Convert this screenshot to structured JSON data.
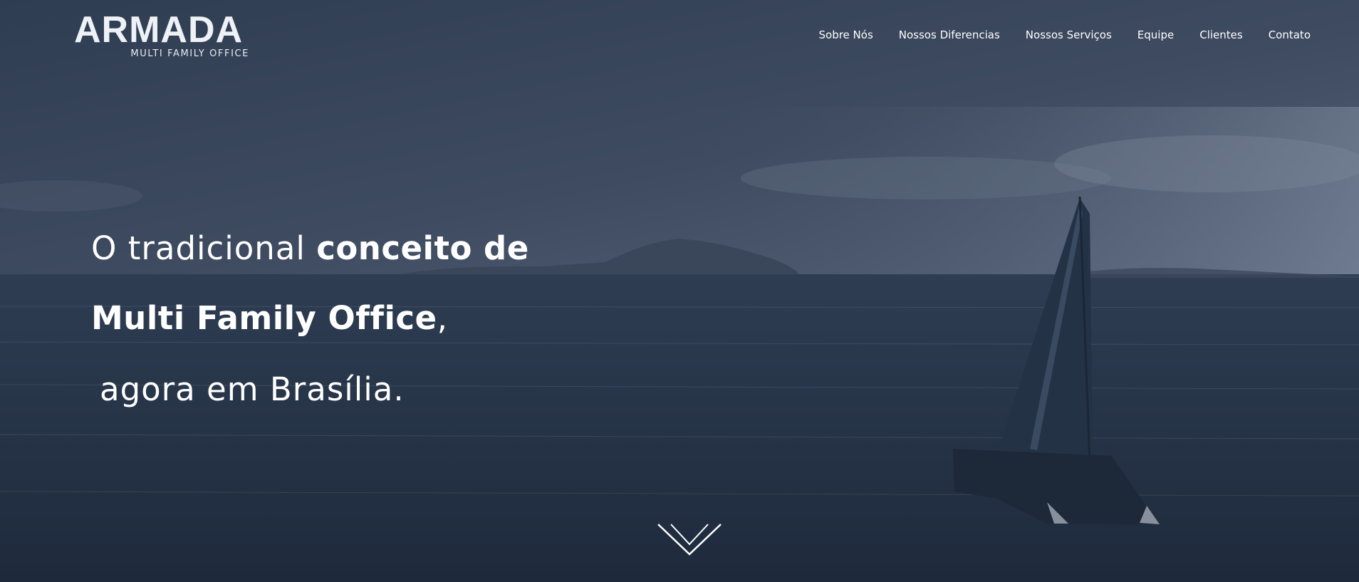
{
  "brand": {
    "logo_word": "ARMADA",
    "logo_subtitle": "MULTI FAMILY OFFICE"
  },
  "nav": {
    "items": [
      {
        "label": "Sobre Nós"
      },
      {
        "label": "Nossos Diferencias"
      },
      {
        "label": "Nossos Serviços"
      },
      {
        "label": "Equipe"
      },
      {
        "label": "Clientes"
      },
      {
        "label": "Contato"
      }
    ]
  },
  "hero": {
    "line1_light": "O tradicional ",
    "line1_bold": "conceito de",
    "line2_bold": "Multi Family Office",
    "line2_light": ",",
    "line3_light": "agora em Brasília."
  },
  "icons": {
    "scroll": "chevron-down-icon"
  },
  "colors": {
    "overlay": "#2b3a4e",
    "text": "#ffffff"
  }
}
